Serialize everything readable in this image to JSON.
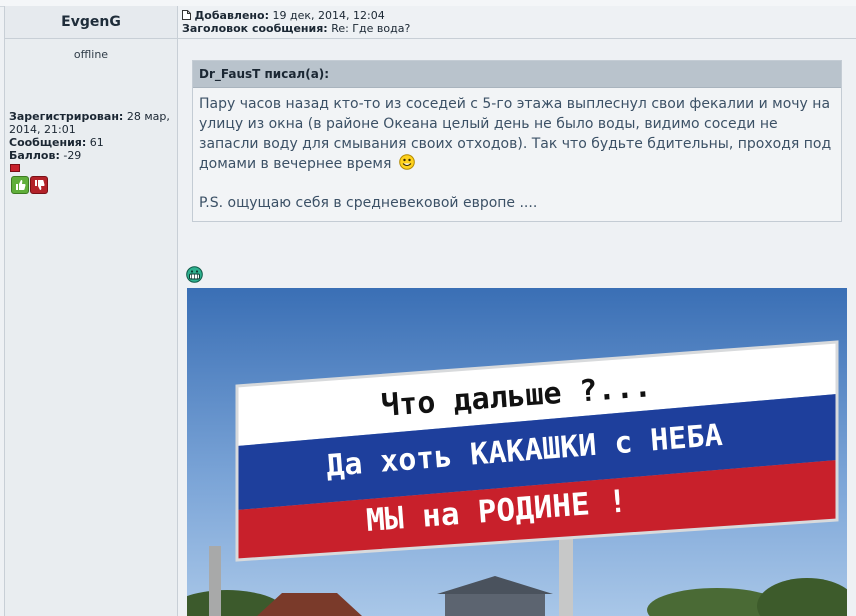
{
  "user": {
    "name": "EvgenG",
    "status": "offline",
    "registered_label": "Зарегистрирован:",
    "registered_value": "28 мар, 2014, 21:01",
    "messages_label": "Сообщения:",
    "messages_value": "61",
    "points_label": "Баллов:",
    "points_value": "-29"
  },
  "post": {
    "added_label": "Добавлено:",
    "added_value": "19 дек, 2014, 12:04",
    "subject_label": "Заголовок сообщения:",
    "subject_value": "Re: Где вода?"
  },
  "quote": {
    "author": "Dr_FausT писал(а):",
    "text": "Пару часов назад кто-то из соседей с 5-го этажа выплеснул свои фекалии и мочу на улицу из окна (в районе Океана целый день не было воды, видимо соседи не запасли воду для смывания своих отходов). Так что будьте бдительны, проходя под домами в вечернее время",
    "ps": "P.S. ощущаю себя в средневековой европе ...."
  },
  "billboard": {
    "line1": "Что дальше ?...",
    "line2": "Да хоть КАКАШКИ  с НЕБА",
    "line3": "МЫ на РОДИНЕ !"
  },
  "colors": {
    "flag_white": "#ffffff",
    "flag_blue": "#1e3f9c",
    "flag_red": "#c8202b",
    "quote_text": "#3c5166"
  },
  "icons": [
    "post-icon",
    "thumbs-up-icon",
    "thumbs-down-icon",
    "smiley-icon",
    "grin-icon"
  ]
}
